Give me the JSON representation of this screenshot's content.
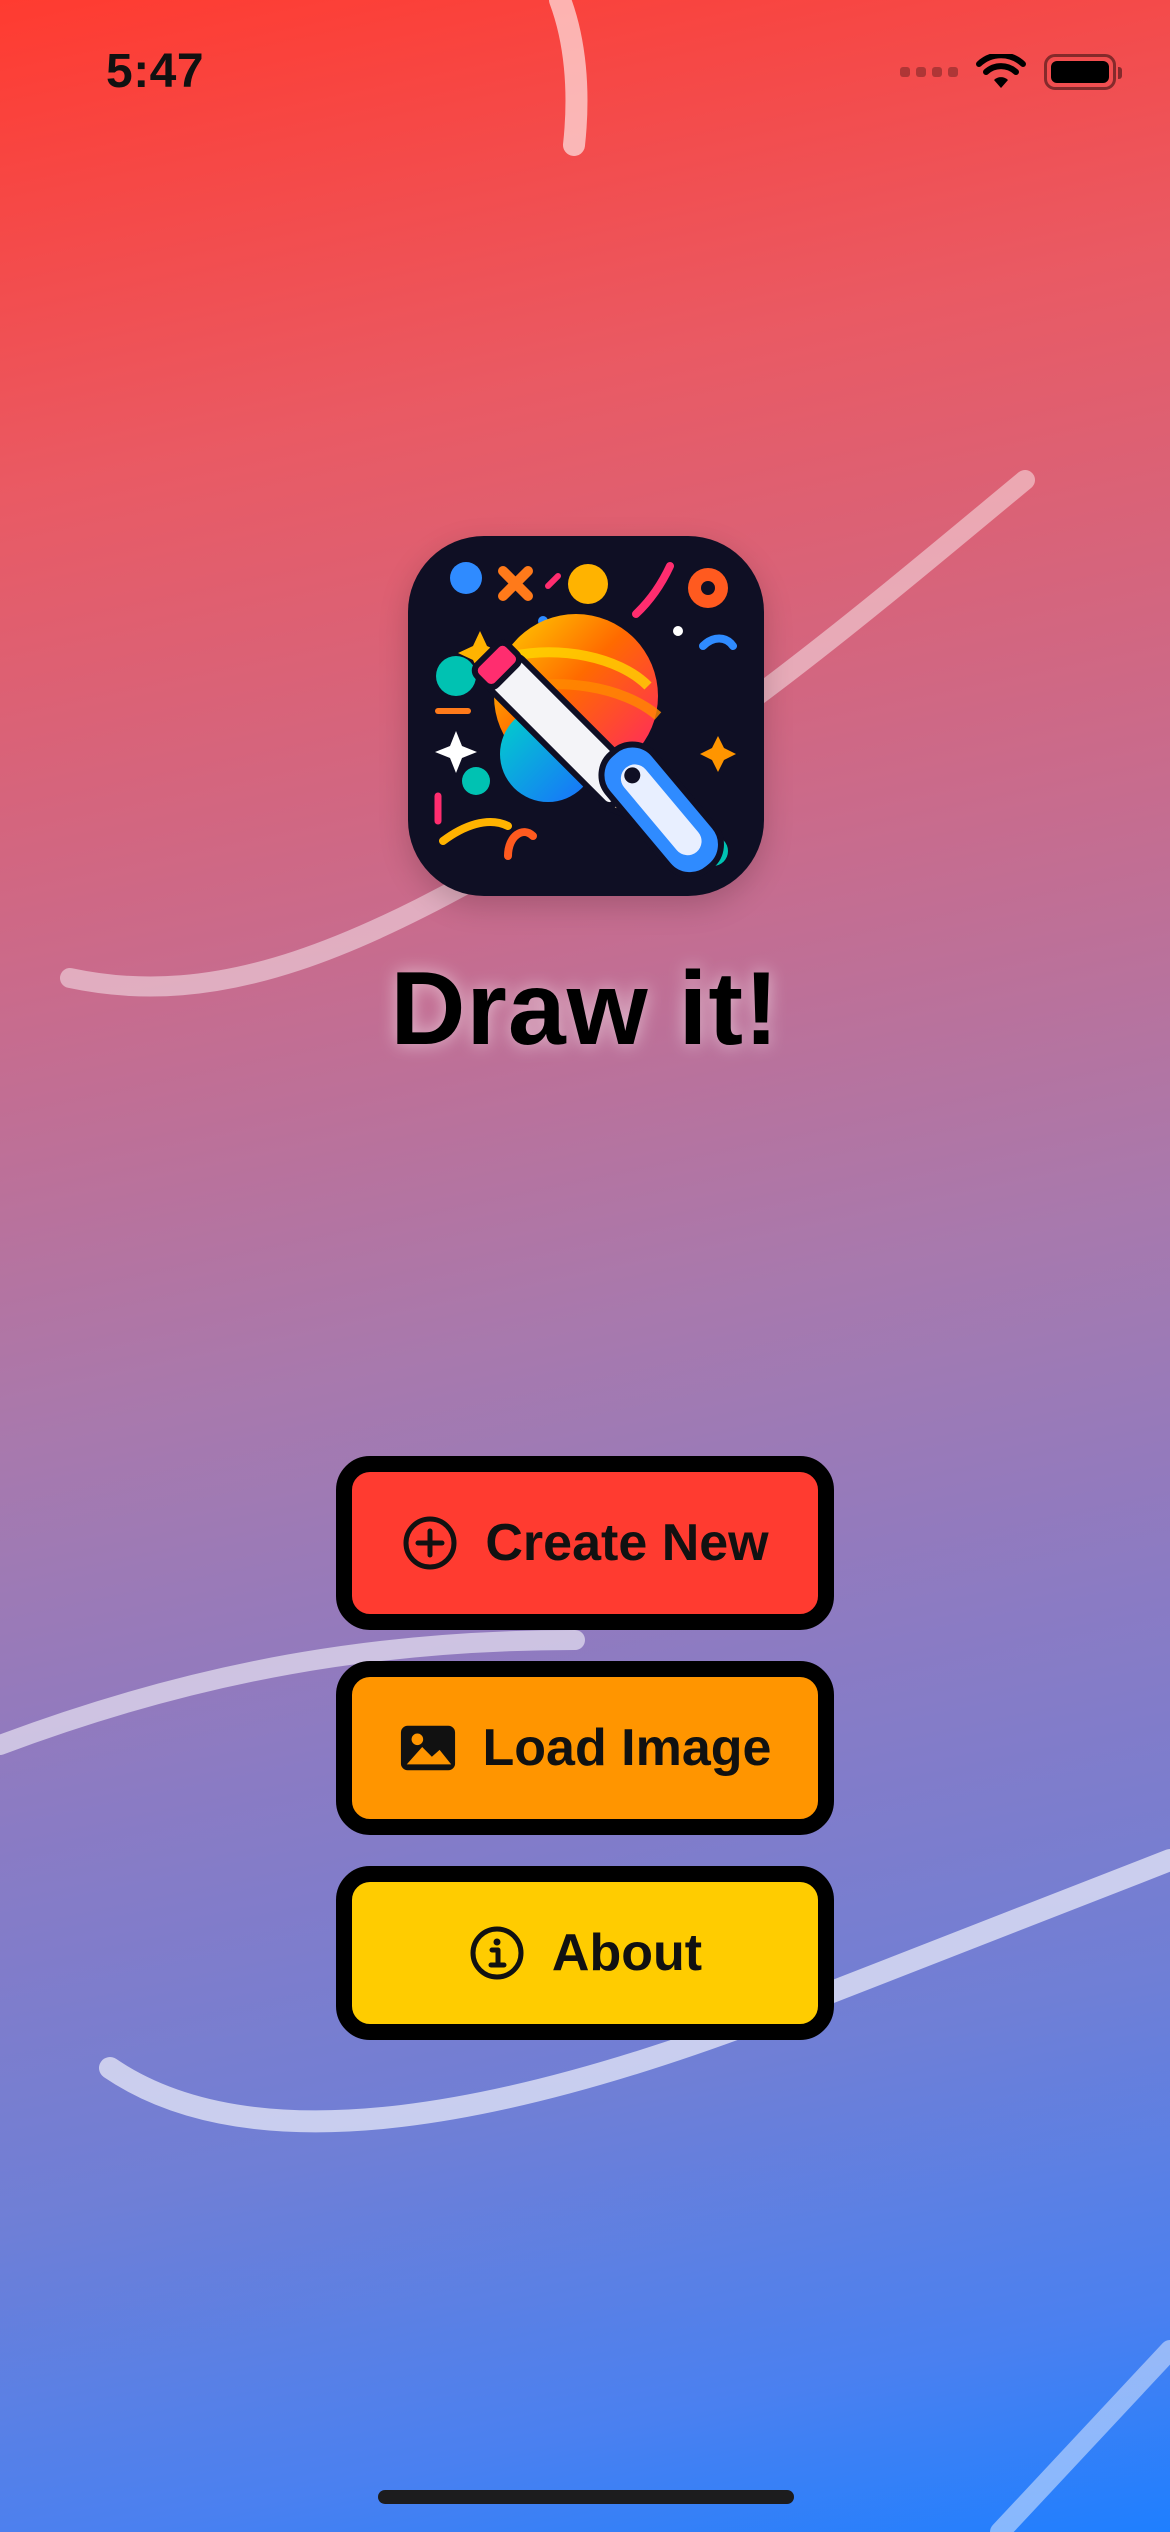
{
  "status_bar": {
    "time": "5:47",
    "icons": [
      "cellular-signal-icon",
      "wifi-icon",
      "battery-icon"
    ]
  },
  "app": {
    "title": "Draw it!",
    "icon": "app-logo-palette-pencil"
  },
  "menu": {
    "create_new": {
      "label": "Create New",
      "icon": "plus-circle-icon",
      "color": "#ff3b30"
    },
    "load_image": {
      "label": "Load Image",
      "icon": "photo-icon",
      "color": "#ff9500"
    },
    "about": {
      "label": "About",
      "icon": "info-circle-icon",
      "color": "#ffcc00"
    }
  },
  "theme": {
    "gradient_top": "#ff3b30",
    "gradient_bottom": "#1e7fff",
    "button_border": "#000000"
  }
}
